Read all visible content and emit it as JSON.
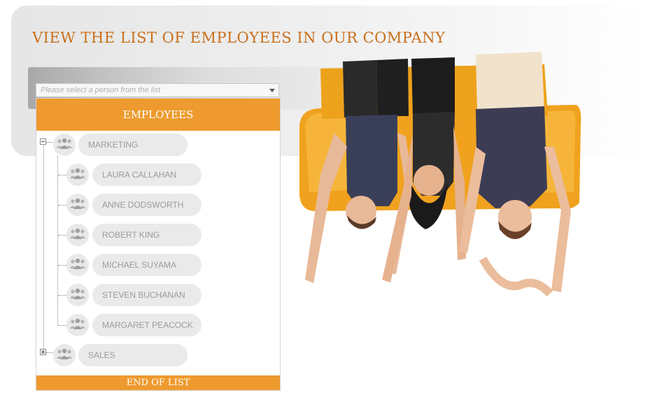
{
  "page": {
    "title": "VIEW THE LIST OF EMPLOYEES IN OUR COMPANY"
  },
  "select": {
    "placeholder": "Please select a person from the list"
  },
  "panel": {
    "header": "EMPLOYEES",
    "footer": "END OF LIST",
    "groups": [
      {
        "label": "MARKETING",
        "expanded": true,
        "employees": [
          "LAURA CALLAHAN",
          "ANNE DODSWORTH",
          "ROBERT KING",
          "MICHAEL SUYAMA",
          "STEVEN BUCHANAN",
          "MARGARET PEACOCK"
        ]
      },
      {
        "label": "SALES",
        "expanded": false,
        "employees": []
      }
    ]
  },
  "icons": {
    "node": "people-group-icon",
    "expand": "plus-icon",
    "collapse": "minus-icon"
  },
  "colors": {
    "accent": "#ee9a2e",
    "title": "#c9701c",
    "pill": "#eaeaea",
    "sofa": "#f0a21e"
  }
}
